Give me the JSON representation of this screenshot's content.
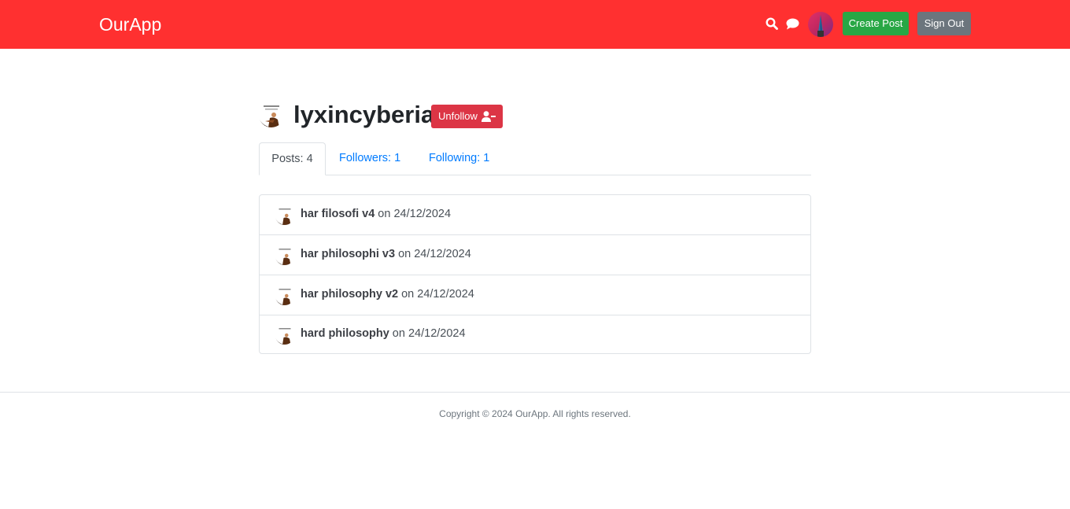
{
  "navbar": {
    "brand": "OurApp",
    "search_icon": "search-icon",
    "chat_icon": "chat-icon",
    "create_post_label": "Create Post",
    "sign_out_label": "Sign Out"
  },
  "profile": {
    "username": "lyxincyberia",
    "unfollow_label": "Unfollow",
    "unfollow_icon": "user-minus-icon"
  },
  "tabs": [
    {
      "label": "Posts: 4",
      "active": true
    },
    {
      "label": "Followers: 1",
      "active": false
    },
    {
      "label": "Following: 1",
      "active": false
    }
  ],
  "posts": [
    {
      "title": "har filosofi v4",
      "date_text": " on 24/12/2024"
    },
    {
      "title": "har philosophi v3",
      "date_text": " on 24/12/2024"
    },
    {
      "title": "har philosophy v2",
      "date_text": " on 24/12/2024"
    },
    {
      "title": "hard philosophy",
      "date_text": " on 24/12/2024"
    }
  ],
  "footer": {
    "copyright": "Copyright © 2024 OurApp. All rights reserved."
  },
  "colors": {
    "navbar": "#ff3030",
    "create_post": "#28a745",
    "sign_out": "#6c757d",
    "unfollow": "#dc3545",
    "link": "#007bff"
  }
}
